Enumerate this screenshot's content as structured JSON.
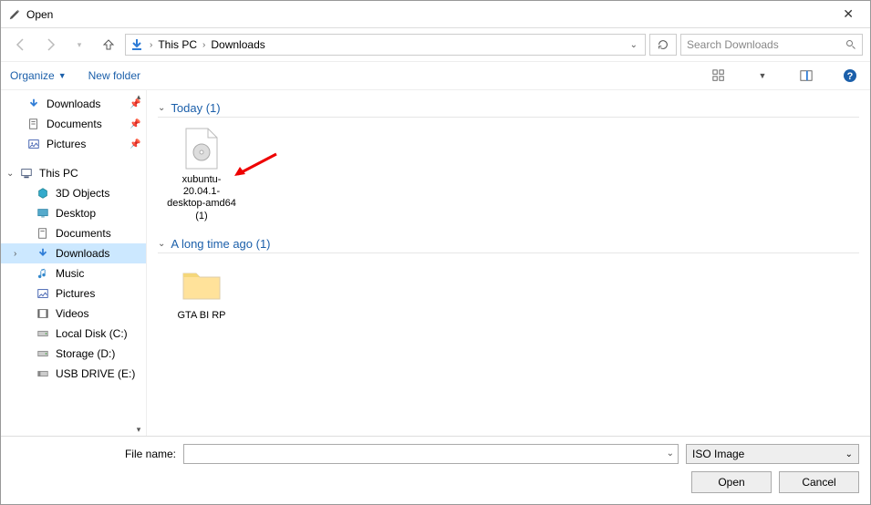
{
  "window": {
    "title": "Open"
  },
  "nav": {
    "breadcrumb": {
      "root": "This PC",
      "current": "Downloads"
    },
    "search_placeholder": "Search Downloads"
  },
  "toolbar": {
    "organize": "Organize",
    "new_folder": "New folder"
  },
  "sidebar": {
    "quick": [
      {
        "label": "Downloads",
        "icon": "download",
        "pinned": true
      },
      {
        "label": "Documents",
        "icon": "document",
        "pinned": true
      },
      {
        "label": "Pictures",
        "icon": "pictures",
        "pinned": true
      }
    ],
    "thispc_label": "This PC",
    "thispc": [
      {
        "label": "3D Objects",
        "icon": "3d"
      },
      {
        "label": "Desktop",
        "icon": "desktop"
      },
      {
        "label": "Documents",
        "icon": "document"
      },
      {
        "label": "Downloads",
        "icon": "download",
        "selected": true
      },
      {
        "label": "Music",
        "icon": "music"
      },
      {
        "label": "Pictures",
        "icon": "pictures"
      },
      {
        "label": "Videos",
        "icon": "videos"
      },
      {
        "label": "Local Disk (C:)",
        "icon": "disk"
      },
      {
        "label": "Storage (D:)",
        "icon": "disk"
      },
      {
        "label": "USB DRIVE (E:)",
        "icon": "usb"
      }
    ]
  },
  "content": {
    "groups": [
      {
        "header": "Today (1)",
        "items": [
          {
            "label": "xubuntu-20.04.1-desktop-amd64 (1)",
            "icon": "iso",
            "annotated": true
          }
        ]
      },
      {
        "header": "A long time ago (1)",
        "items": [
          {
            "label": "GTA BI RP",
            "icon": "folder"
          }
        ]
      }
    ]
  },
  "footer": {
    "filename_label": "File name:",
    "filename_value": "",
    "filetype": "ISO Image",
    "open": "Open",
    "cancel": "Cancel"
  }
}
